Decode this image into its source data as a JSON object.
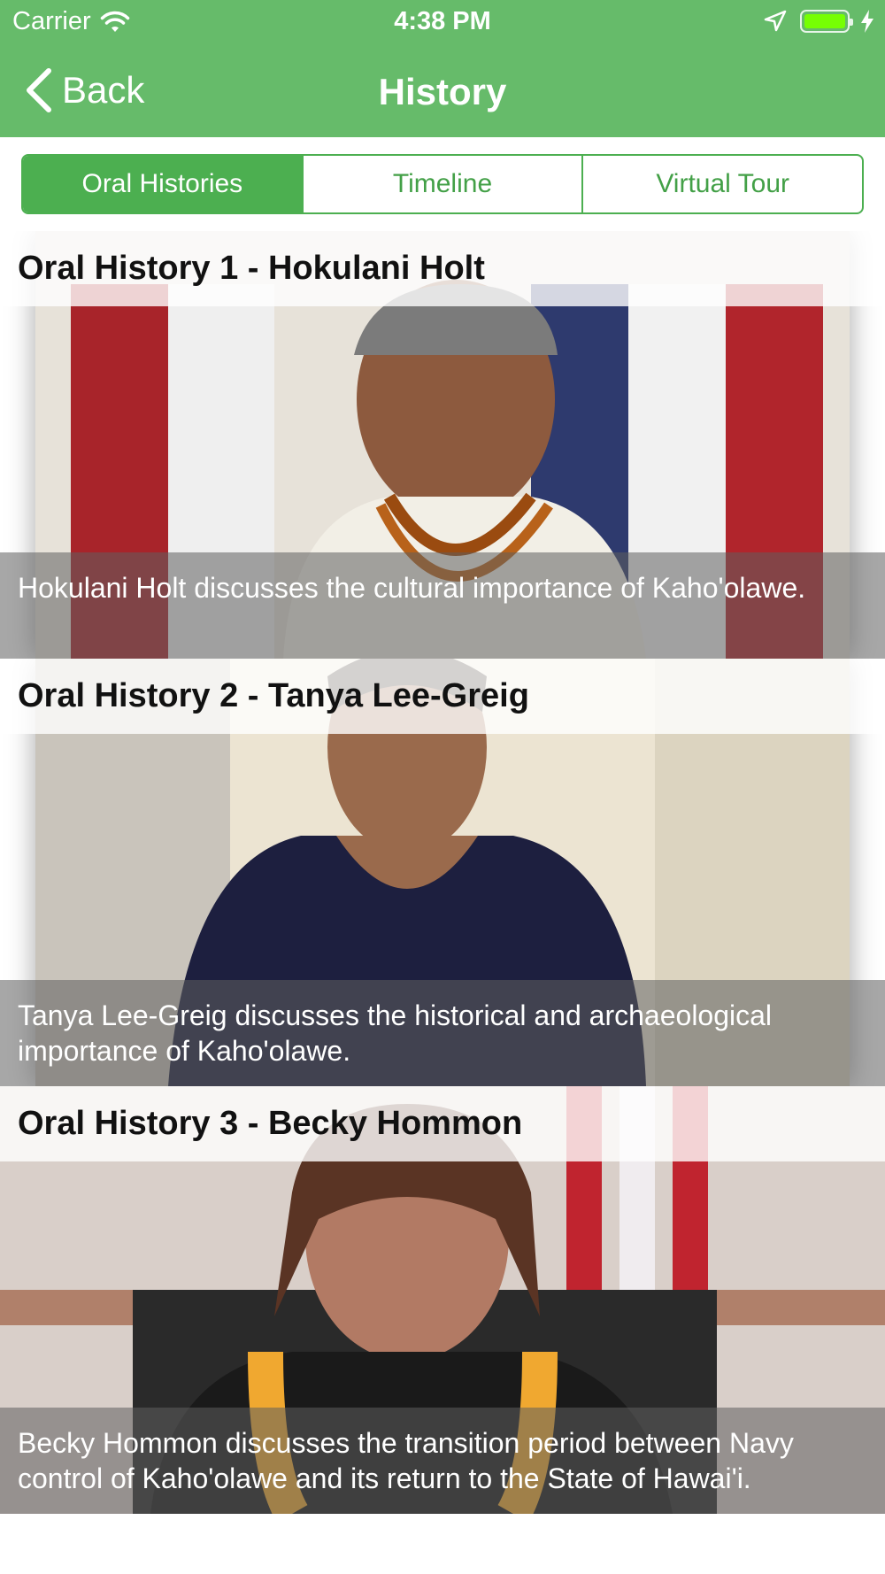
{
  "status_bar": {
    "carrier": "Carrier",
    "time": "4:38 PM",
    "wifi_icon": "wifi-icon",
    "location_icon": "location-arrow-icon",
    "battery_icon": "battery-icon",
    "charging_icon": "charging-bolt-icon"
  },
  "nav": {
    "back_label": "Back",
    "back_icon": "chevron-left-icon",
    "title": "History"
  },
  "tabs": [
    {
      "label": "Oral Histories",
      "active": true
    },
    {
      "label": "Timeline",
      "active": false
    },
    {
      "label": "Virtual Tour",
      "active": false
    }
  ],
  "items": [
    {
      "title": "Oral History 1 - Hokulani Holt",
      "description": "Hokulani Holt discusses the cultural importance of Kaho'olawe."
    },
    {
      "title": "Oral History 2 - Tanya Lee-Greig",
      "description": " Tanya Lee-Greig discusses the historical and archaeological importance of Kaho'olawe."
    },
    {
      "title": "Oral History 3 - Becky Hommon",
      "description": "Becky Hommon discusses the transition period between Navy control of Kaho'olawe and its return to the State of Hawai'i."
    }
  ],
  "colors": {
    "accent": "#66bb6a",
    "segment_active": "#4caf50"
  }
}
